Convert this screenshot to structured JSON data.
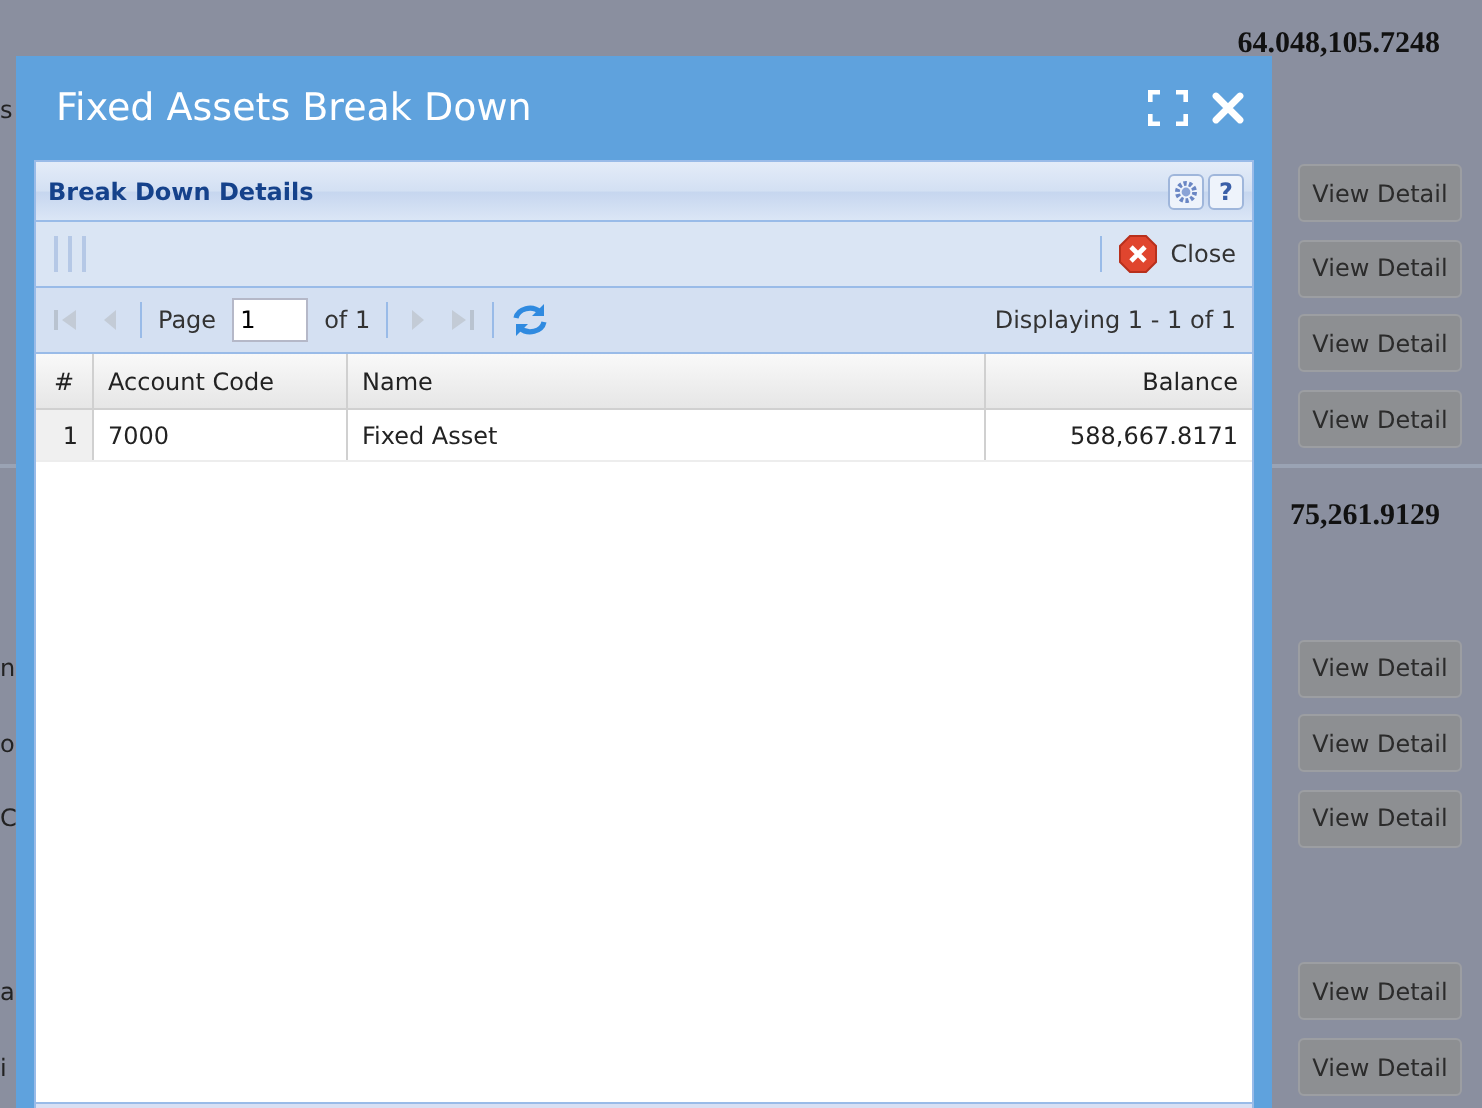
{
  "background": {
    "sections": [
      {
        "total": "64.048,105.7248",
        "rows": [
          {
            "label": "s"
          },
          {
            "button": "View Detail"
          },
          {
            "button": "View Detail"
          },
          {
            "button": "View Detail"
          },
          {
            "button": "View Detail"
          }
        ]
      },
      {
        "total": "75,261.9129",
        "rows": [
          {
            "label": "n",
            "button": "View Detail"
          },
          {
            "label": "o",
            "button": "View Detail"
          },
          {
            "label": "C",
            "button": "View Detail"
          }
        ]
      },
      {
        "rows": [
          {
            "label": "a",
            "button": "View Detail"
          },
          {
            "label": "i",
            "button": "View Detail"
          }
        ]
      }
    ]
  },
  "window": {
    "title": "Fixed Assets Break Down"
  },
  "panel": {
    "title": "Break Down Details",
    "help": "?"
  },
  "toolbar": {
    "close": "Close"
  },
  "paging": {
    "page_label": "Page",
    "page": "1",
    "of": "of 1",
    "display": "Displaying 1 - 1 of 1"
  },
  "table": {
    "columns": [
      "#",
      "Account Code",
      "Name",
      "Balance"
    ],
    "rows": [
      [
        "1",
        "7000",
        "Fixed Asset",
        "588,667.8171"
      ]
    ]
  }
}
